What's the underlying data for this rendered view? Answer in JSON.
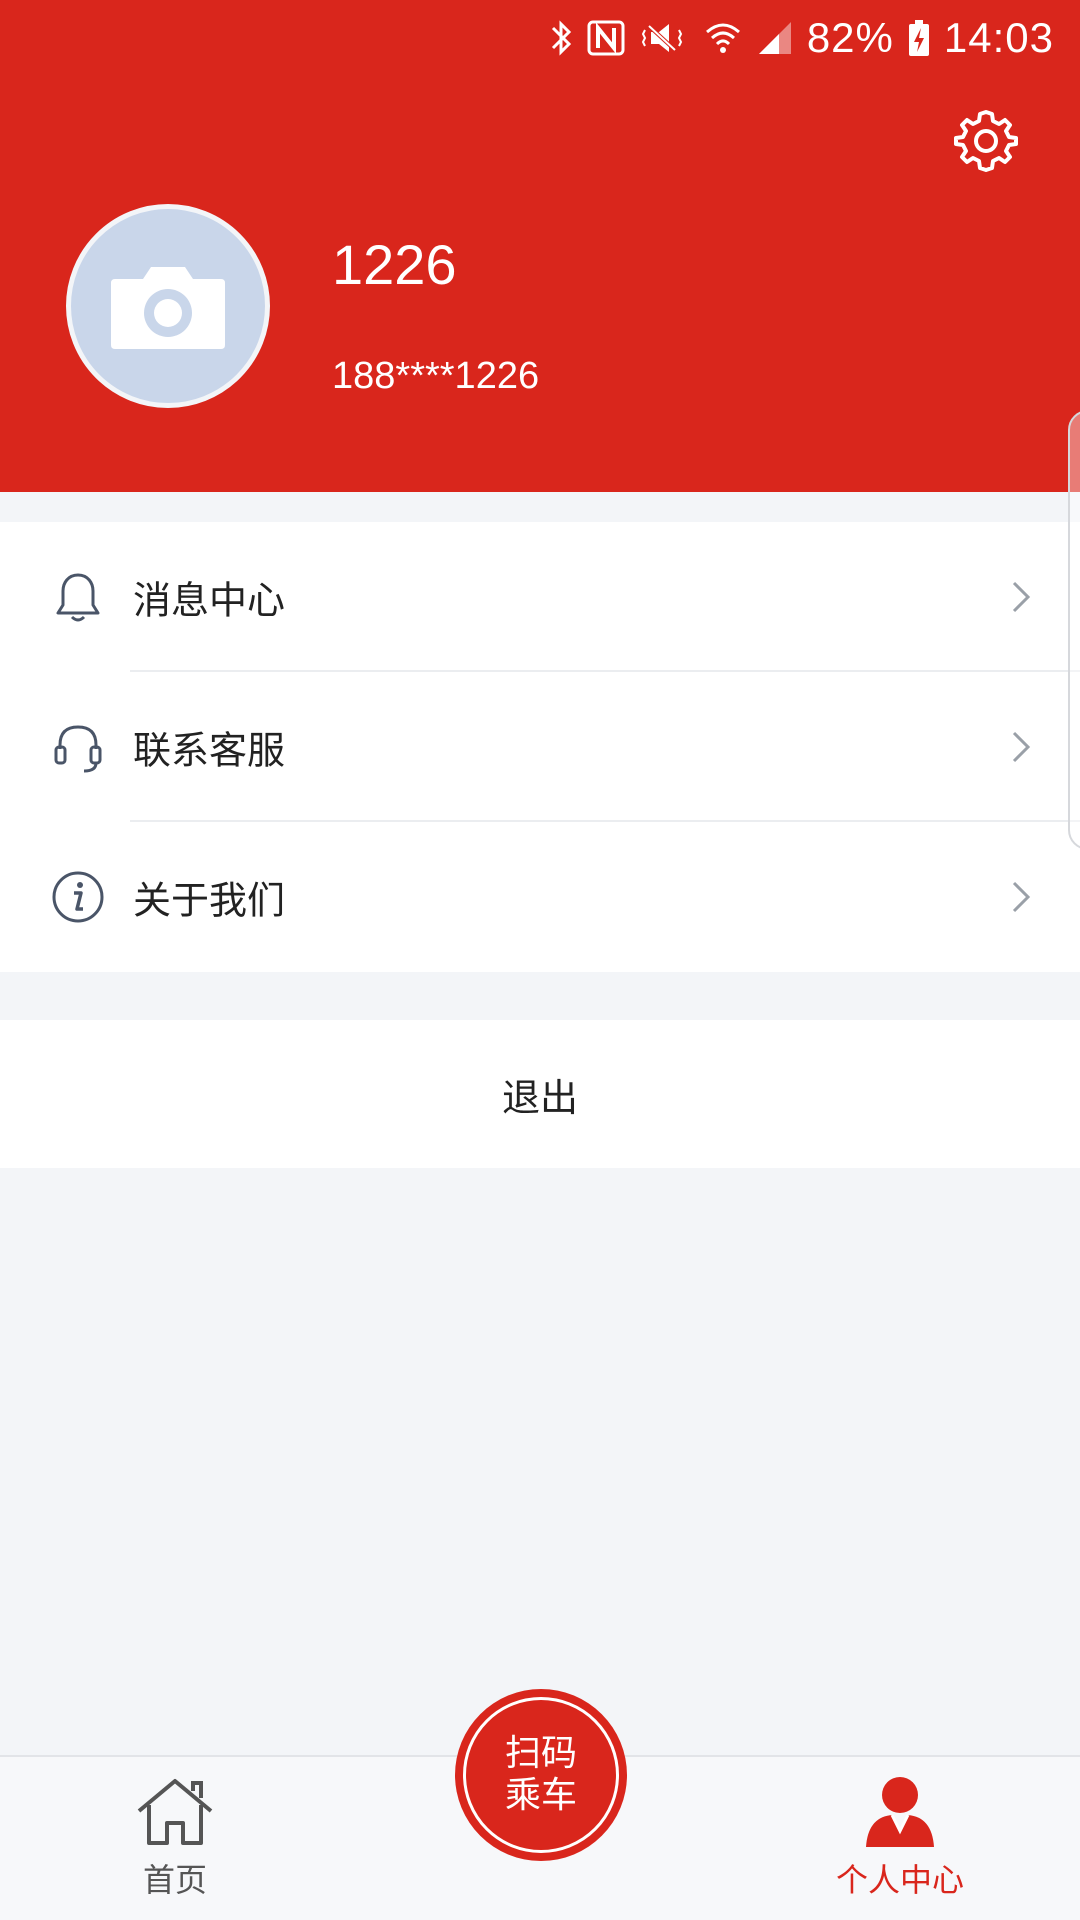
{
  "status_bar": {
    "battery_percent": "82%",
    "time": "14:03",
    "icons": [
      "bluetooth-icon",
      "nfc-icon",
      "vibrate-icon",
      "wifi-icon",
      "signal-icon",
      "battery-charging-icon"
    ]
  },
  "profile": {
    "name": "1226",
    "phone": "188****1226",
    "avatar_icon": "camera-icon"
  },
  "settings_icon": "gear-icon",
  "menu": {
    "items": [
      {
        "label": "消息中心",
        "icon": "bell-icon"
      },
      {
        "label": "联系客服",
        "icon": "headset-icon"
      },
      {
        "label": "关于我们",
        "icon": "info-icon"
      }
    ]
  },
  "logout_label": "退出",
  "bottom_nav": {
    "home_label": "首页",
    "scan_label": "扫码乘车",
    "me_label": "个人中心",
    "active": "me"
  },
  "colors": {
    "brand_red": "#d9261c",
    "background": "#f3f5f8",
    "avatar_bg": "#c9d6ea"
  }
}
